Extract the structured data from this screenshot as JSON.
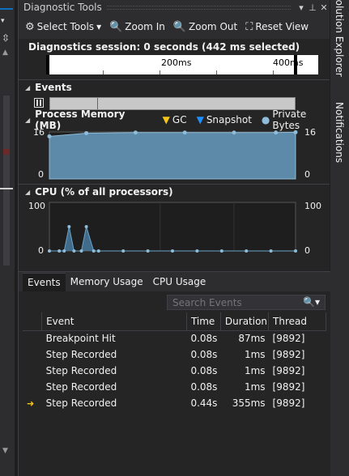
{
  "window": {
    "title": "Diagnostic Tools",
    "session_label": "Diagnostics session: 0 seconds (442 ms selected)"
  },
  "toolbar": {
    "select_tools": "Select Tools",
    "zoom_in": "Zoom In",
    "zoom_out": "Zoom Out",
    "reset_view": "Reset View"
  },
  "ruler": {
    "ticks": [
      "200ms",
      "400ms"
    ]
  },
  "events_section": {
    "title": "Events"
  },
  "memory_section": {
    "title": "Process Memory (MB)",
    "legend": {
      "gc": "GC",
      "snapshot": "Snapshot",
      "private_bytes": "Private Bytes"
    },
    "y_max": "16",
    "y_min": "0"
  },
  "cpu_section": {
    "title": "CPU (% of all processors)",
    "y_max": "100",
    "y_min": "0"
  },
  "colors": {
    "accent": "#0e70c0",
    "memory_fill": "#5d8aa8",
    "cpu_line": "#6aa2c8",
    "pointer": "#f5c518"
  },
  "chart_data": [
    {
      "type": "area",
      "title": "Process Memory (MB)",
      "x": [
        0,
        0.15,
        0.35,
        0.55,
        0.75,
        0.92,
        1.0
      ],
      "values": [
        14.5,
        15.6,
        15.8,
        15.8,
        15.8,
        15.8,
        15.9
      ],
      "ylim": [
        0,
        16
      ],
      "series": [
        {
          "name": "Private Bytes",
          "values": [
            14.5,
            15.6,
            15.8,
            15.8,
            15.8,
            15.8,
            15.9
          ]
        }
      ]
    },
    {
      "type": "line",
      "title": "CPU (% of all processors)",
      "x": [
        0,
        0.04,
        0.06,
        0.08,
        0.1,
        0.13,
        0.15,
        0.18,
        0.2,
        0.3,
        0.4,
        0.5,
        0.6,
        0.7,
        0.8,
        0.9,
        1.0
      ],
      "values": [
        0,
        0,
        0,
        50,
        0,
        0,
        50,
        0,
        0,
        0,
        0,
        0,
        0,
        0,
        0,
        0,
        0
      ],
      "ylim": [
        0,
        100
      ]
    }
  ],
  "bottom": {
    "tabs": [
      "Events",
      "Memory Usage",
      "CPU Usage"
    ],
    "search_placeholder": "Search Events",
    "columns": [
      "Event",
      "Time",
      "Duration",
      "Thread"
    ],
    "rows": [
      {
        "event": "Breakpoint Hit",
        "time": "0.08s",
        "duration": "87ms",
        "thread": "[9892]",
        "current": false
      },
      {
        "event": "Step Recorded",
        "time": "0.08s",
        "duration": "1ms",
        "thread": "[9892]",
        "current": false
      },
      {
        "event": "Step Recorded",
        "time": "0.08s",
        "duration": "1ms",
        "thread": "[9892]",
        "current": false
      },
      {
        "event": "Step Recorded",
        "time": "0.08s",
        "duration": "1ms",
        "thread": "[9892]",
        "current": false
      },
      {
        "event": "Step Recorded",
        "time": "0.44s",
        "duration": "355ms",
        "thread": "[9892]",
        "current": true
      }
    ]
  },
  "right_tabs": {
    "solution_explorer": "Solution Explorer",
    "notifications": "Notifications"
  }
}
